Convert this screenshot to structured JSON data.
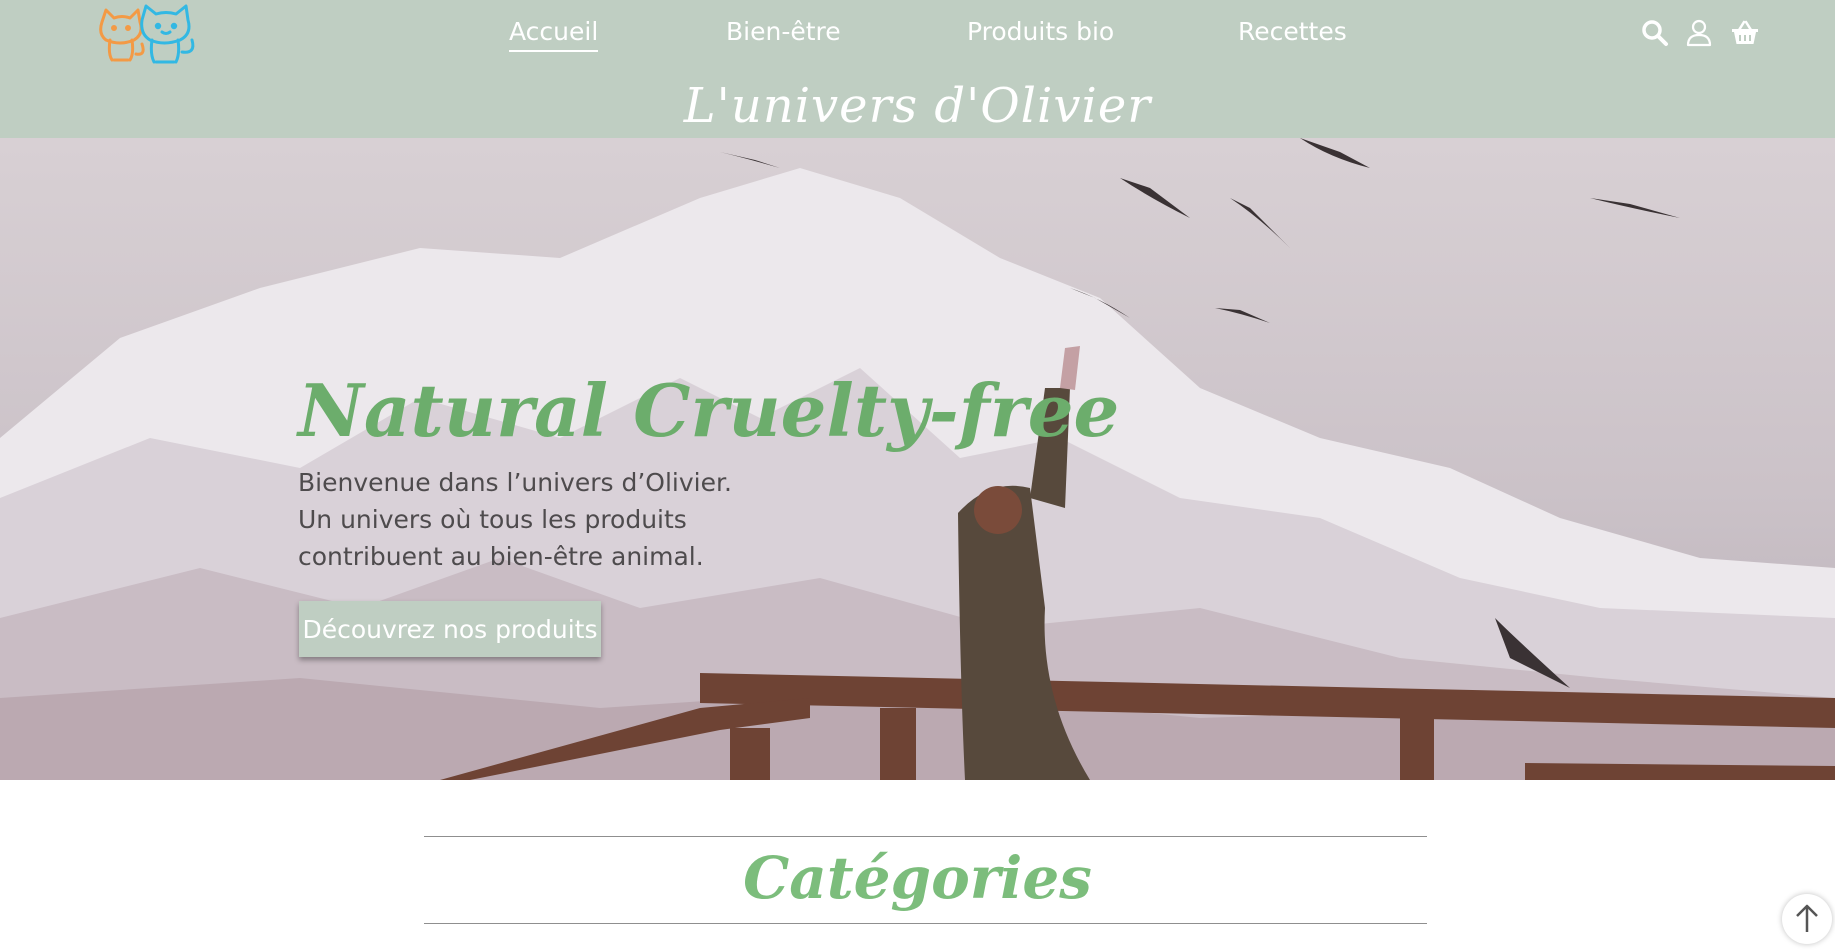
{
  "header": {
    "logo_icon": "two-cats-logo-icon",
    "site_title": "L'univers d'Olivier",
    "background_color": "#bfcec2",
    "nav": [
      {
        "label": "Accueil",
        "active": true
      },
      {
        "label": "Bien-être",
        "active": false
      },
      {
        "label": "Produits bio",
        "active": false
      },
      {
        "label": "Recettes",
        "active": false
      }
    ],
    "icons": [
      "search-icon",
      "user-icon",
      "basket-icon"
    ]
  },
  "hero": {
    "heading": "Natural Cruelty-free",
    "heading_color": "#6cad6c",
    "text_lines": [
      "Bienvenue dans l’univers d’Olivier.",
      "Un univers où tous les produits",
      "contribuent au bien-être animal."
    ],
    "cta_label": "Découvrez nos produits"
  },
  "categories": {
    "title": "Catégories",
    "title_color": "#7cbd7c"
  },
  "scroll_top_icon": "arrow-up-icon"
}
